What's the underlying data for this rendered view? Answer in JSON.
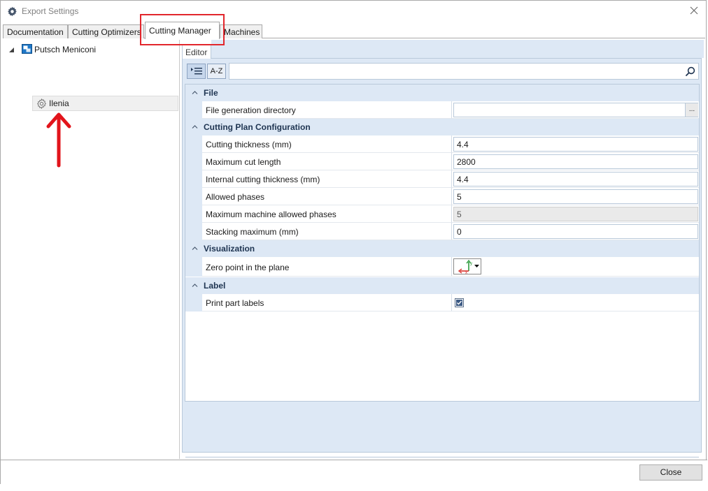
{
  "window": {
    "title": "Export Settings"
  },
  "tabs": [
    {
      "label": "Documentation",
      "active": false
    },
    {
      "label": "Cutting Optimizers",
      "active": false
    },
    {
      "label": "Cutting Manager",
      "active": true
    },
    {
      "label": "Machines",
      "active": false
    }
  ],
  "tree": {
    "root": {
      "label": "Putsch Meniconi",
      "expanded": true
    },
    "child": {
      "label": "Ilenia",
      "selected": true
    }
  },
  "editor": {
    "tab_label": "Editor",
    "toolbar": {
      "categorized_label": "",
      "alphabetical_label": "A-Z",
      "search_placeholder": ""
    },
    "categories": [
      {
        "label": "File",
        "properties": [
          {
            "name": "File generation directory",
            "value": "",
            "browse_label": "..."
          }
        ]
      },
      {
        "label": "Cutting Plan Configuration",
        "properties": [
          {
            "name": "Cutting thickness (mm)",
            "value": "4.4"
          },
          {
            "name": "Maximum cut length",
            "value": "2800"
          },
          {
            "name": "Internal cutting thickness (mm)",
            "value": "4.4"
          },
          {
            "name": "Allowed phases",
            "value": "5"
          },
          {
            "name": "Maximum machine allowed phases",
            "value": "5",
            "readonly": true
          },
          {
            "name": "Stacking maximum (mm)",
            "value": "0"
          }
        ]
      },
      {
        "label": "Visualization",
        "properties": [
          {
            "name": "Zero point in the plane",
            "icon": "axis-origin-icon"
          }
        ]
      },
      {
        "label": "Label",
        "properties": [
          {
            "name": "Print part labels",
            "checked": true
          }
        ]
      }
    ]
  },
  "footer": {
    "close_label": "Close"
  },
  "colors": {
    "highlight": "#e2262c",
    "accent": "#dde8f5",
    "arrow": "#e2141b"
  }
}
